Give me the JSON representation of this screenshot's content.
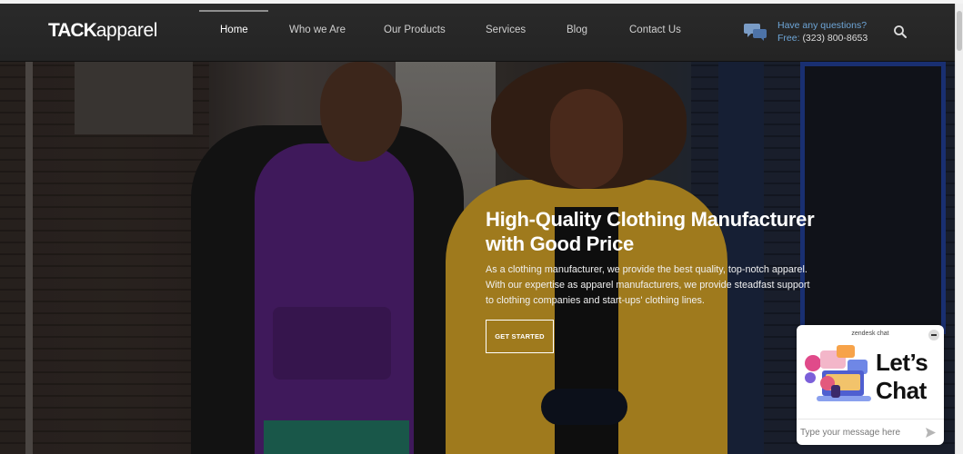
{
  "brand": {
    "logo_bold": "TACK",
    "logo_light": "apparel"
  },
  "nav": {
    "items": [
      {
        "label": "Home",
        "active": true
      },
      {
        "label": "Who we Are"
      },
      {
        "label": "Our Products"
      },
      {
        "label": "Services"
      },
      {
        "label": "Blog"
      },
      {
        "label": "Contact Us"
      }
    ]
  },
  "contact": {
    "question": "Have any questions?",
    "free_label": "Free:",
    "phone": "(323) 800-8653"
  },
  "icons": {
    "contact": "chat-bubbles-icon",
    "search": "search-icon",
    "send": "send-icon",
    "minimize": "minimize-icon"
  },
  "hero": {
    "title_line1": "High-Quality Clothing Manufacturer",
    "title_line2": "with Good Price",
    "text_line1": "As a clothing manufacturer, we provide the best quality, top-notch apparel.",
    "text_line2": "With our expertise as apparel manufacturers, we provide steadfast support",
    "text_line3": "to clothing companies and start-ups' clothing lines.",
    "cta_label": "GET STARTED"
  },
  "chat": {
    "brand": "zendesk chat",
    "headline_line1": "Let’s",
    "headline_line2": "Chat",
    "input_placeholder": "Type your message here"
  },
  "colors": {
    "header_bg": "#262626",
    "accent_blue": "#6ea6d8",
    "chat_bg": "#ffffff"
  }
}
